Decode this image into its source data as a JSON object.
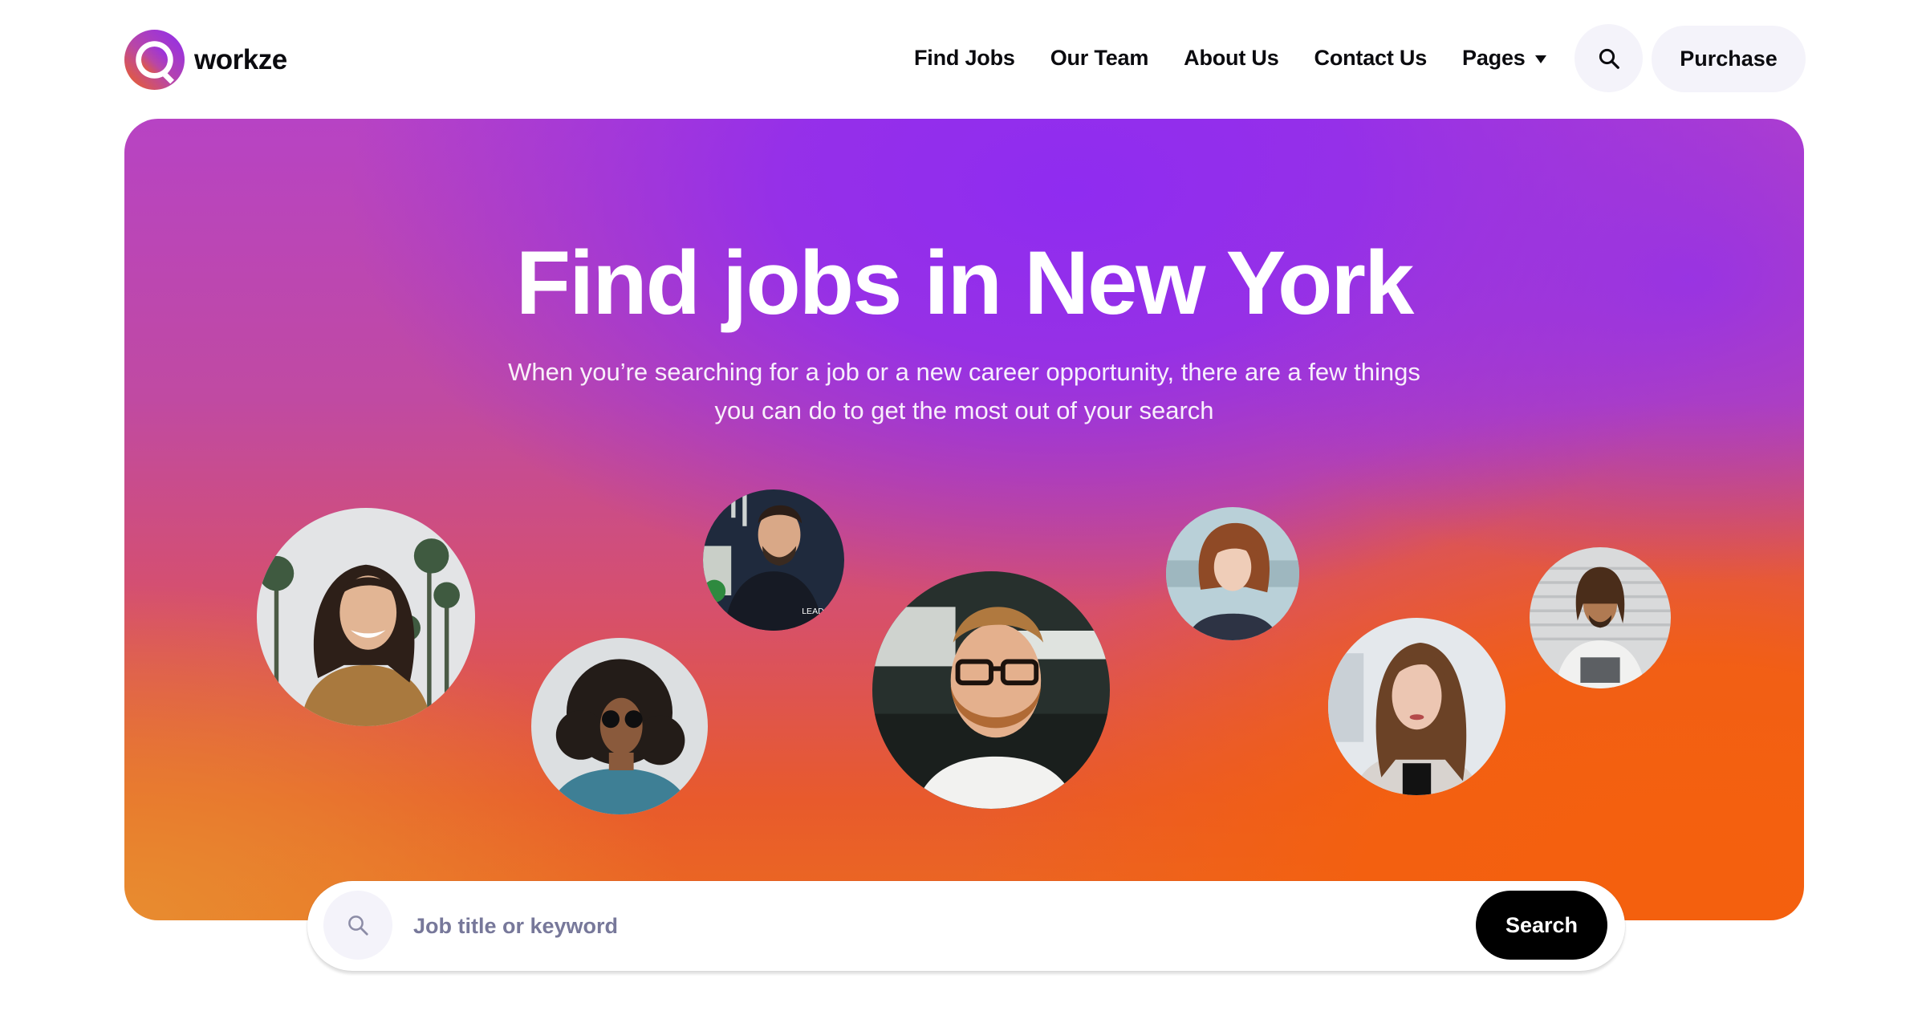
{
  "brand": {
    "name": "workze",
    "logo_icon": "q-ring-logo",
    "gradient_from": "#8f2cf0",
    "gradient_to": "#f0621a"
  },
  "nav": {
    "links": [
      {
        "label": "Find Jobs"
      },
      {
        "label": "Our Team"
      },
      {
        "label": "About Us"
      },
      {
        "label": "Contact Us"
      },
      {
        "label": "Pages",
        "icon": "caret-down-icon"
      }
    ],
    "search_icon": "search-icon",
    "purchase_label": "Purchase"
  },
  "hero": {
    "title": "Find jobs in New York",
    "subtitle_line1": "When you’re searching for a job or a new career opportunity, there are a few things",
    "subtitle_line2": "you can do to get the most out of your search",
    "colors": {
      "violet": "#8f2cf0",
      "magenta": "#b743c4",
      "orange": "#f2600f",
      "amber": "#e8862e"
    },
    "avatars": [
      {
        "name": "smiling woman with palm trees"
      },
      {
        "name": "man with curly hair and sunglasses"
      },
      {
        "name": "man in black hoodie"
      },
      {
        "name": "bearded man with glasses"
      },
      {
        "name": "woman with red bob hair"
      },
      {
        "name": "woman with long brown hair"
      },
      {
        "name": "man with dreadlocks"
      }
    ]
  },
  "search": {
    "icon": "search-icon",
    "placeholder": "Job title or keyword",
    "value": "",
    "button_label": "Search"
  }
}
